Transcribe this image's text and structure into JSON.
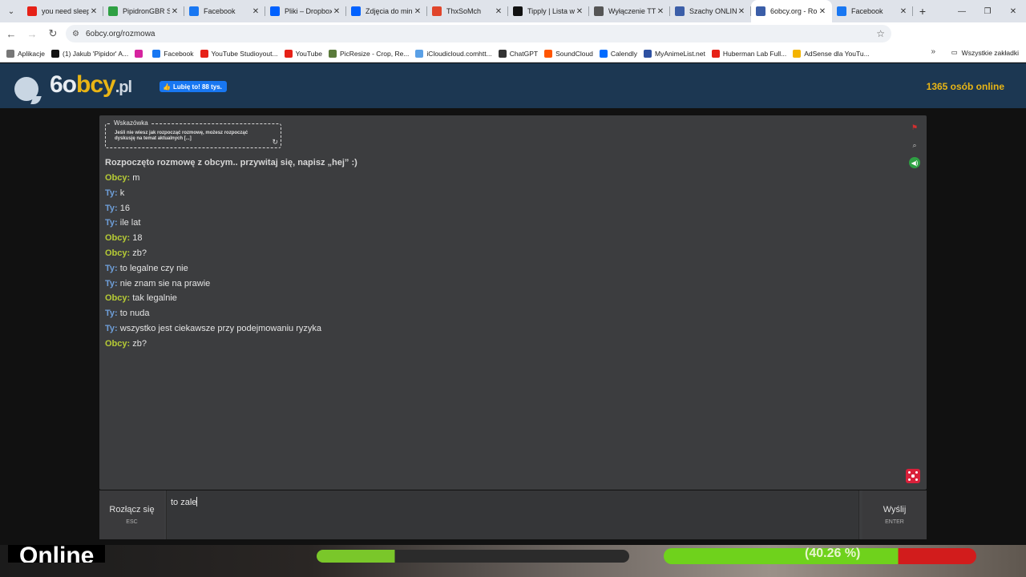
{
  "browser": {
    "tabs": [
      {
        "title": "you need sleep",
        "color": "#e62117",
        "icon": "youtube-icon"
      },
      {
        "title": "PipidronGBR S",
        "color": "#2ea043",
        "icon": "app-icon"
      },
      {
        "title": "Facebook",
        "color": "#1877f2",
        "icon": "facebook-icon"
      },
      {
        "title": "Pliki – Dropbox",
        "color": "#0061fe",
        "icon": "dropbox-icon"
      },
      {
        "title": "Zdjęcia do min",
        "color": "#0061fe",
        "icon": "dropbox-icon"
      },
      {
        "title": "ThxSoMch",
        "color": "#e0452b",
        "icon": "soundcloud-icon"
      },
      {
        "title": "Tipply | Lista w",
        "color": "#111111",
        "icon": "tipply-icon"
      },
      {
        "title": "Wyłączenie TT",
        "color": "#555555",
        "icon": "chatgpt-icon"
      },
      {
        "title": "Szachy ONLINE",
        "color": "#3b5ea8",
        "icon": "chess-icon"
      },
      {
        "title": "6obcy.org - Ro",
        "color": "#3b5ea8",
        "icon": "site-icon"
      },
      {
        "title": "Facebook",
        "color": "#1877f2",
        "icon": "facebook-icon"
      }
    ],
    "url": "6obcy.org/rozmowa",
    "bookmarks": [
      {
        "label": "Aplikacje",
        "color": "#777777"
      },
      {
        "label": "(1) Jakub 'Pipidor' A...",
        "color": "#111111"
      },
      {
        "label": "",
        "color": "#d6249f"
      },
      {
        "label": "Facebook",
        "color": "#1877f2"
      },
      {
        "label": "YouTube Studioyout...",
        "color": "#e62117"
      },
      {
        "label": "YouTube",
        "color": "#e62117"
      },
      {
        "label": "PicResize - Crop, Re...",
        "color": "#5a7a3a"
      },
      {
        "label": "iCloudicloud.comhtt...",
        "color": "#5aa0e6"
      },
      {
        "label": "ChatGPT",
        "color": "#333333"
      },
      {
        "label": "SoundCloud",
        "color": "#ff5500"
      },
      {
        "label": "Calendly",
        "color": "#006bff"
      },
      {
        "label": "MyAnimeList.net",
        "color": "#2e51a2"
      },
      {
        "label": "Huberman Lab Full...",
        "color": "#e62117"
      },
      {
        "label": "AdSense dla YouTu...",
        "color": "#f4b400"
      }
    ],
    "all_bookmarks": "Wszystkie zakładki"
  },
  "site": {
    "logo_main": "6o",
    "logo_accent": "bcy",
    "logo_tld": ".pl",
    "fb_like": "Lubię to! 88 tys.",
    "online": "1365 osób online"
  },
  "hint": {
    "title": "Wskazówka",
    "text": "Jeśli nie wiesz jak rozpocząć rozmowę, możesz rozpocząć dyskusję na temat aktualnych [...]"
  },
  "chat": {
    "intro": "Rozpoczęto rozmowę z obcym.. przywitaj się, napisz „hej” :)",
    "messages": [
      {
        "who": "Obcy:",
        "type": "stranger",
        "text": "m"
      },
      {
        "who": "Ty:",
        "type": "you",
        "text": "k"
      },
      {
        "who": "Ty:",
        "type": "you",
        "text": "16"
      },
      {
        "who": "Ty:",
        "type": "you",
        "text": "ile lat"
      },
      {
        "who": "Obcy:",
        "type": "stranger",
        "text": "18"
      },
      {
        "who": "Obcy:",
        "type": "stranger",
        "text": "zb?"
      },
      {
        "who": "Ty:",
        "type": "you",
        "text": "to legalne czy nie"
      },
      {
        "who": "Ty:",
        "type": "you",
        "text": "nie znam sie na prawie"
      },
      {
        "who": "Obcy:",
        "type": "stranger",
        "text": "tak legalnie"
      },
      {
        "who": "Ty:",
        "type": "you",
        "text": "to nuda"
      },
      {
        "who": "Ty:",
        "type": "you",
        "text": "wszystko jest ciekawsze przy podejmowaniu ryzyka"
      },
      {
        "who": "Obcy:",
        "type": "stranger",
        "text": "zb?"
      }
    ]
  },
  "controls": {
    "disconnect_label": "Rozłącz się",
    "disconnect_key": "ESC",
    "input_value": "to zale",
    "send_label": "Wyślij",
    "send_key": "ENTER"
  },
  "overlay": {
    "percent_text": "(40.26 %)",
    "online_text": "Online"
  }
}
